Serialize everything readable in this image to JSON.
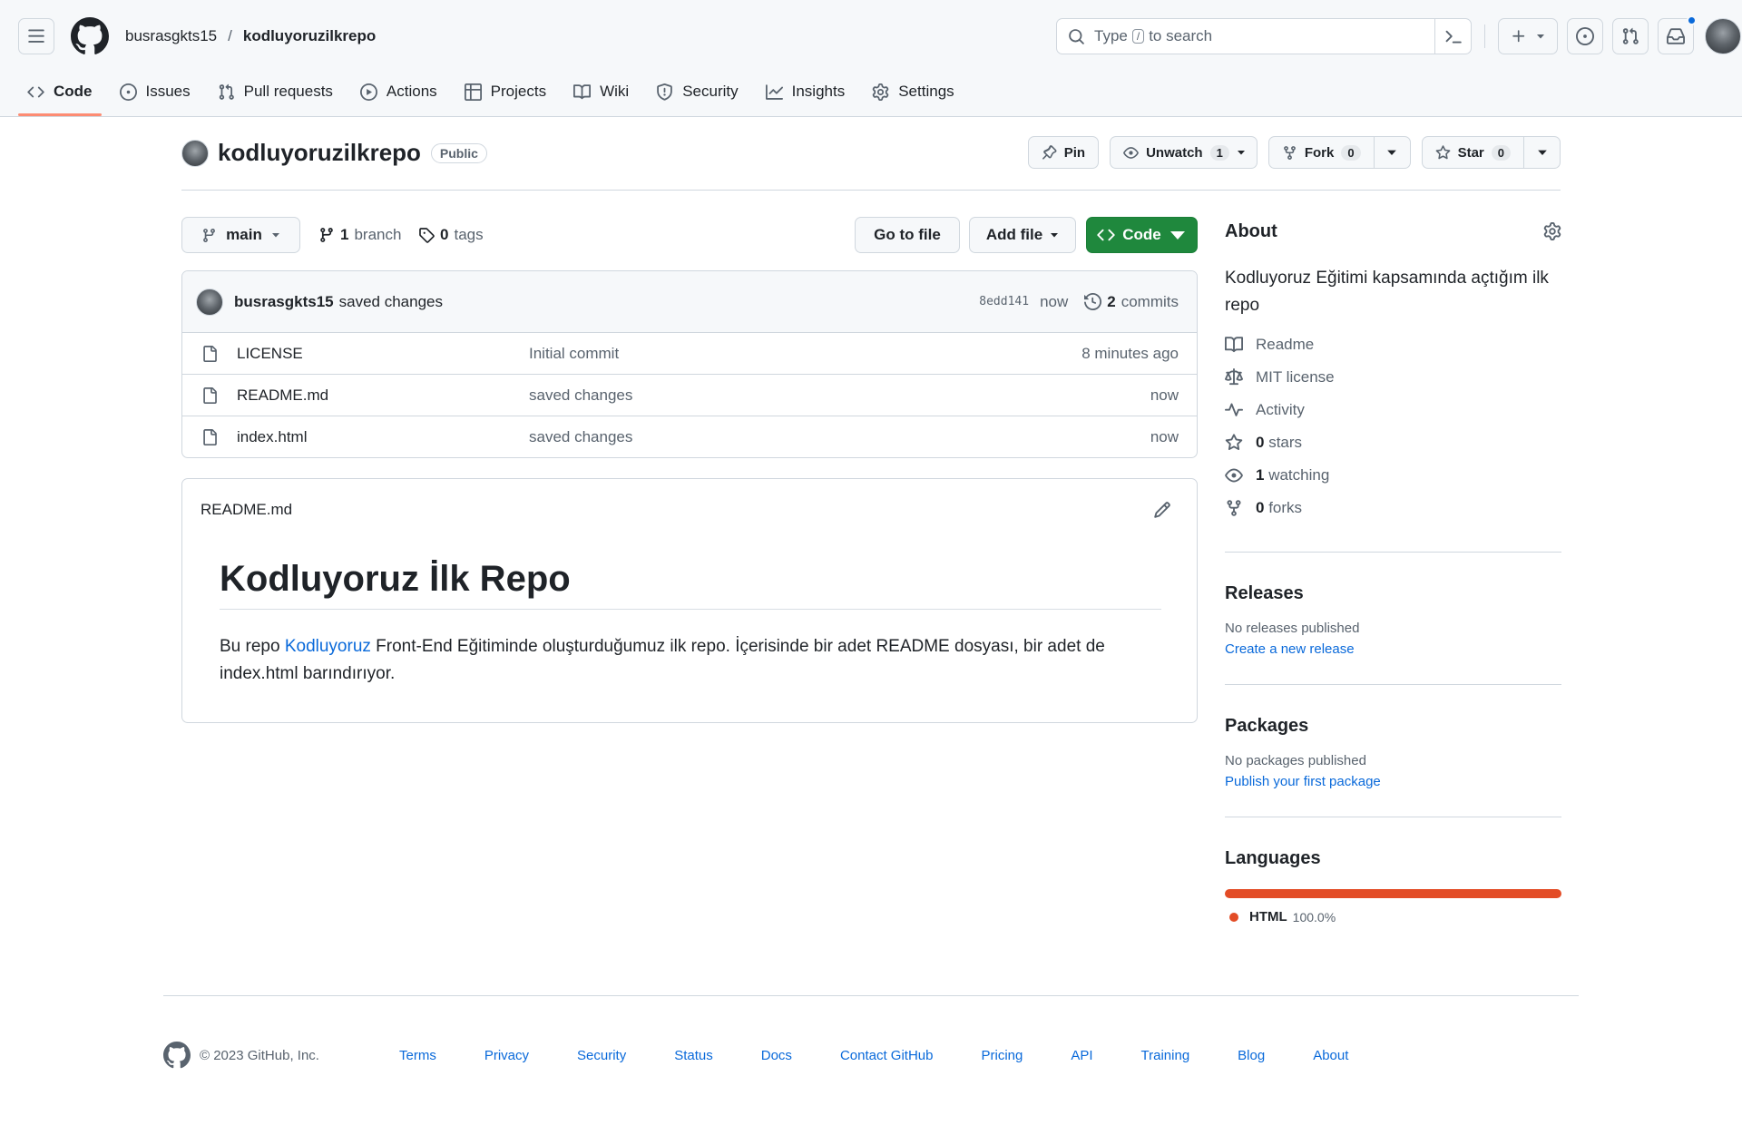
{
  "header": {
    "owner": "busrasgkts15",
    "separator": "/",
    "repo": "kodluyoruzilkrepo",
    "search": {
      "prefix": "Type",
      "key": "/",
      "suffix": "to search"
    }
  },
  "tabs": [
    {
      "label": "Code",
      "icon": "code-icon",
      "active": true
    },
    {
      "label": "Issues",
      "icon": "issue-opened-icon"
    },
    {
      "label": "Pull requests",
      "icon": "git-pull-request-icon"
    },
    {
      "label": "Actions",
      "icon": "play-icon"
    },
    {
      "label": "Projects",
      "icon": "table-icon"
    },
    {
      "label": "Wiki",
      "icon": "book-icon"
    },
    {
      "label": "Security",
      "icon": "shield-icon"
    },
    {
      "label": "Insights",
      "icon": "graph-icon"
    },
    {
      "label": "Settings",
      "icon": "gear-icon"
    }
  ],
  "repo_header": {
    "name": "kodluyoruzilkrepo",
    "visibility": "Public",
    "pin_label": "Pin",
    "unwatch_label": "Unwatch",
    "unwatch_count": "1",
    "fork_label": "Fork",
    "fork_count": "0",
    "star_label": "Star",
    "star_count": "0"
  },
  "filenav": {
    "branch": "main",
    "branch_count": "1",
    "branch_word": "branch",
    "tag_count": "0",
    "tag_word": "tags",
    "go_to_file": "Go to file",
    "add_file": "Add file",
    "code": "Code"
  },
  "latest_commit": {
    "author": "busrasgkts15",
    "message": "saved changes",
    "sha": "8edd141",
    "time": "now",
    "commit_count": "2",
    "commit_word": "commits"
  },
  "files": [
    {
      "name": "LICENSE",
      "message": "Initial commit",
      "age": "8 minutes ago"
    },
    {
      "name": "README.md",
      "message": "saved changes",
      "age": "now"
    },
    {
      "name": "index.html",
      "message": "saved changes",
      "age": "now"
    }
  ],
  "readme": {
    "filename": "README.md",
    "heading": "Kodluyoruz İlk Repo",
    "text_before": "Bu repo ",
    "link": "Kodluyoruz",
    "text_after": " Front-End Eğitiminde oluşturduğumuz ilk repo. İçerisinde bir adet README dosyası, bir adet de index.html barındırıyor."
  },
  "about": {
    "title": "About",
    "description": "Kodluyoruz Eğitimi kapsamında açtığım ilk repo",
    "items": [
      {
        "icon": "book-icon",
        "count": "",
        "label": "Readme"
      },
      {
        "icon": "law-icon",
        "count": "",
        "label": "MIT license"
      },
      {
        "icon": "pulse-icon",
        "count": "",
        "label": "Activity"
      },
      {
        "icon": "star-icon",
        "count": "0",
        "label": "stars"
      },
      {
        "icon": "eye-icon",
        "count": "1",
        "label": "watching"
      },
      {
        "icon": "repo-forked-icon",
        "count": "0",
        "label": "forks"
      }
    ]
  },
  "releases": {
    "title": "Releases",
    "note": "No releases published",
    "link": "Create a new release"
  },
  "packages": {
    "title": "Packages",
    "note": "No packages published",
    "link": "Publish your first package"
  },
  "languages": {
    "title": "Languages",
    "items": [
      {
        "name": "HTML",
        "percent": "100.0%",
        "color": "#e34c26",
        "share": 1.0
      }
    ]
  },
  "footer": {
    "copyright": "© 2023 GitHub, Inc.",
    "links": [
      "Terms",
      "Privacy",
      "Security",
      "Status",
      "Docs",
      "Contact GitHub",
      "Pricing",
      "API",
      "Training",
      "Blog",
      "About"
    ]
  },
  "colors": {
    "accent_link": "#0969da",
    "primary_green": "#1f883d",
    "tab_underline": "#fd8c73",
    "html_language": "#e34c26",
    "notification_dot": "#0969da"
  }
}
